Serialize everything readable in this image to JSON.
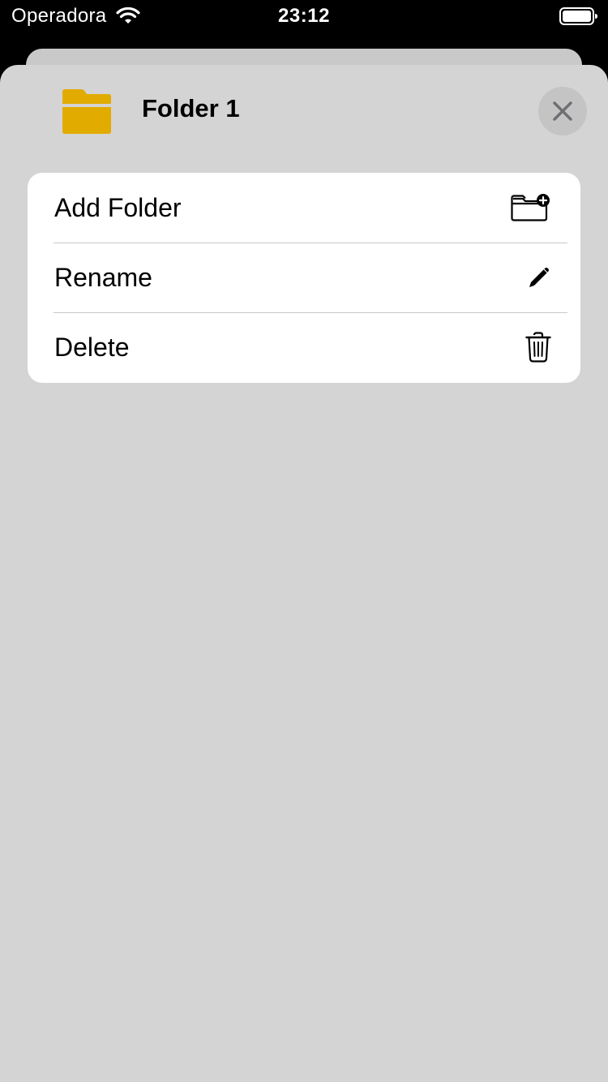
{
  "status_bar": {
    "carrier": "Operadora",
    "time": "23:12",
    "wifi_icon": "wifi-icon",
    "battery_icon": "battery-full-icon"
  },
  "sheet": {
    "title": "Folder 1",
    "folder_icon": "folder-icon",
    "folder_color": "#E2AB00",
    "close_icon": "close-icon"
  },
  "menu": {
    "items": [
      {
        "label": "Add Folder",
        "icon": "folder-add-icon"
      },
      {
        "label": "Rename",
        "icon": "pencil-icon"
      },
      {
        "label": "Delete",
        "icon": "trash-icon"
      }
    ]
  },
  "colors": {
    "sheet_background": "#D4D4D4",
    "menu_background": "#FFFFFF",
    "status_bar_background": "#000000"
  }
}
